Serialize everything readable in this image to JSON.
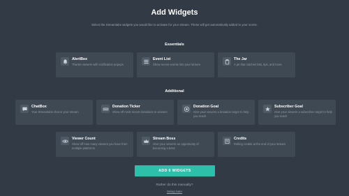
{
  "page": {
    "title": "Add Widgets",
    "subtitle": "Select the Streamlabs widgets you would like to activate for your stream. These will get automatically added to your scene."
  },
  "essentials": {
    "label": "Essentials",
    "cards": [
      {
        "title": "AlertBox",
        "desc": "Thanks viewers with notification popups",
        "icon": "bell-icon"
      },
      {
        "title": "Event List",
        "desc": "Show recent events into your stream",
        "icon": "list-icon"
      },
      {
        "title": "The Jar",
        "desc": "A jar that catches bits, tips, and more",
        "icon": "jar-icon"
      }
    ]
  },
  "additional": {
    "label": "Additional",
    "cards": [
      {
        "title": "ChatBox",
        "desc": "Your Streamlabs chat in your stream",
        "icon": "chat-icon"
      },
      {
        "title": "Donation Ticker",
        "desc": "Show off most recent donations to viewers",
        "icon": "ticker-icon"
      },
      {
        "title": "Donation Goal",
        "desc": "Give your viewers a donation target to help you reach",
        "icon": "goal-icon"
      },
      {
        "title": "Subscriber Goal",
        "desc": "Give your viewers a subscriber target to help you reach",
        "icon": "star-icon"
      },
      {
        "title": "Viewer Count",
        "desc": "Show off how many viewers you have from multiple platforms",
        "icon": "eye-icon"
      },
      {
        "title": "Stream Boss",
        "desc": "Give your viewers an opportunity of becoming a boss",
        "icon": "boss-icon"
      },
      {
        "title": "Credits",
        "desc": "Rolling credits at the end of your stream",
        "icon": "credits-icon"
      }
    ]
  },
  "actions": {
    "add_button": "ADD 0 WIDGETS",
    "manual_question": "Rather do this manually?",
    "manual_link": "Setup later"
  },
  "colors": {
    "background": "#323b45",
    "card": "#3e4954",
    "accent": "#2ebfaa"
  }
}
